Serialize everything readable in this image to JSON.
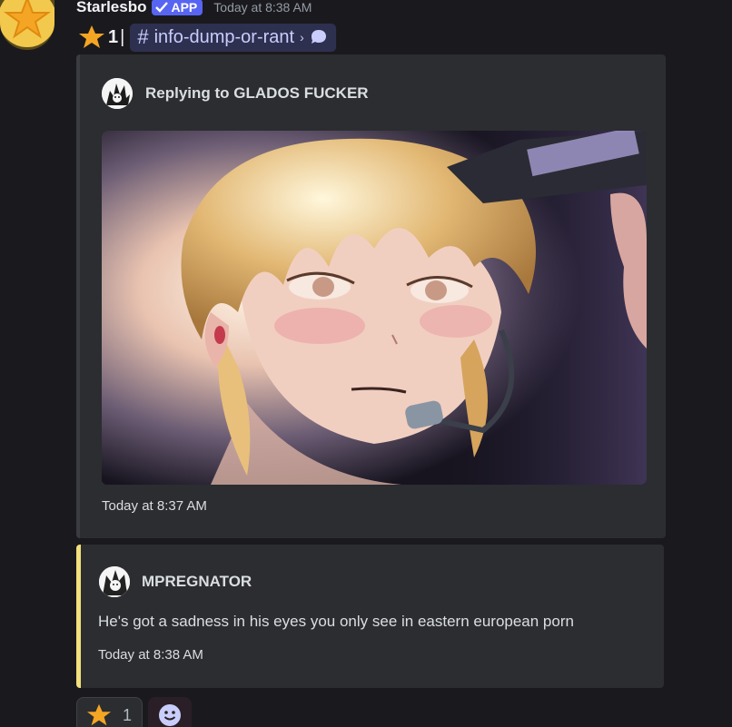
{
  "message": {
    "author": "Starlesbo",
    "badge": "APP",
    "timestamp": "Today at 8:38 AM"
  },
  "starline": {
    "count": "1",
    "separator": "|",
    "channel_hash": "#",
    "channel": "info-dump-or-rant",
    "chevron": "›"
  },
  "reply_card": {
    "title": "Replying to GLADOS FUCKER",
    "timestamp": "Today at 8:37 AM"
  },
  "quote": {
    "author": "MPREGNATOR",
    "text": "He's got a sadness in his eyes you only see in eastern european porn",
    "timestamp": "Today at 8:38 AM"
  },
  "reactions": [
    {
      "emoji": "star-icon",
      "count": "1"
    }
  ],
  "colors": {
    "background": "#1a1a1e",
    "card": "#2b2d31",
    "quote_accent": "#f4e07d",
    "app_badge": "#5865f2",
    "star": "#f5a524"
  }
}
